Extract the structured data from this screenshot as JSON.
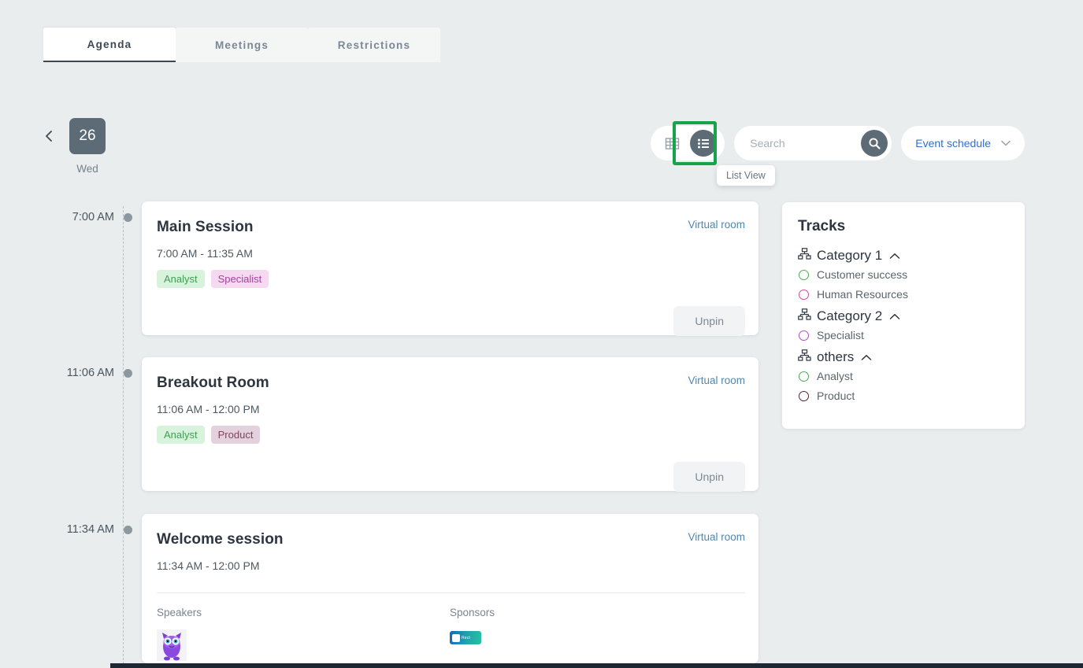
{
  "tabs": [
    {
      "label": "Agenda",
      "active": true
    },
    {
      "label": "Meetings",
      "active": false
    },
    {
      "label": "Restrictions",
      "active": false
    }
  ],
  "datenav": {
    "prev_icon": "chevron-left-icon",
    "next_icon": "chevron-right-icon",
    "day_number": "26",
    "day_of_week": "Wed"
  },
  "toolbar": {
    "grid_view_icon": "grid-view-icon",
    "list_view_icon": "list-view-icon",
    "list_view_active": true,
    "highlight_color": "#16a34a",
    "tooltip": "List View",
    "search": {
      "placeholder": "Search",
      "value": "",
      "button_icon": "search-icon"
    },
    "schedule_select": {
      "label": "Event schedule",
      "chevron_icon": "chevron-down-icon",
      "color": "#2f6fd0"
    }
  },
  "timeline": [
    {
      "time": "7:00 AM"
    },
    {
      "time": "11:06 AM"
    },
    {
      "time": "11:34 AM"
    }
  ],
  "sessions": [
    {
      "title": "Main Session",
      "room_link": "Virtual room",
      "time": "7:00 AM - 11:35 AM",
      "tags": [
        {
          "label": "Analyst",
          "bg": "#d8f3dc",
          "color": "#3f9e52"
        },
        {
          "label": "Specialist",
          "bg": "#f5d9f0",
          "color": "#a4439c"
        }
      ],
      "action": "Unpin"
    },
    {
      "title": "Breakout Room",
      "room_link": "Virtual room",
      "time": "11:06 AM - 12:00 PM",
      "tags": [
        {
          "label": "Analyst",
          "bg": "#d8f3dc",
          "color": "#3f9e52"
        },
        {
          "label": "Product",
          "bg": "#e3d2de",
          "color": "#80445f"
        }
      ],
      "action": "Unpin"
    },
    {
      "title": "Welcome session",
      "room_link": "Virtual room",
      "time": "11:34 AM - 12:00 PM",
      "speakers_label": "Speakers",
      "sponsors_label": "Sponsors",
      "speaker_avatar": "owl-avatar",
      "sponsor_logo_text": "Rect"
    }
  ],
  "tracks": {
    "title": "Tracks",
    "categories": [
      {
        "name": "Category 1",
        "icon": "sitemap-icon",
        "chevron_icon": "chevron-up-icon",
        "items": [
          {
            "label": "Customer success",
            "color": "#4caf50"
          },
          {
            "label": "Human Resources",
            "color": "#cf4f9c"
          }
        ]
      },
      {
        "name": "Category 2",
        "icon": "sitemap-icon",
        "chevron_icon": "chevron-up-icon",
        "items": [
          {
            "label": "Specialist",
            "color": "#b24fc6"
          }
        ]
      },
      {
        "name": "others",
        "icon": "sitemap-icon",
        "chevron_icon": "chevron-up-icon",
        "items": [
          {
            "label": "Analyst",
            "color": "#4caf50"
          },
          {
            "label": "Product",
            "color": "#5e2234"
          }
        ]
      }
    ]
  }
}
